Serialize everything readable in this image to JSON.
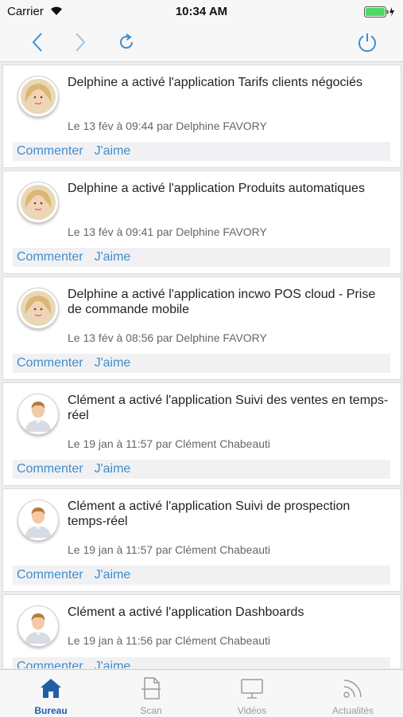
{
  "status_bar": {
    "carrier": "Carrier",
    "time": "10:34 AM"
  },
  "toolbar": {
    "back_icon": "chevron-left-icon",
    "forward_icon": "chevron-right-icon",
    "refresh_icon": "refresh-icon",
    "power_icon": "power-icon",
    "accent_color": "#3f8dcc"
  },
  "feed": {
    "items": [
      {
        "title": "Delphine a activé l'application Tarifs clients négociés",
        "meta": "Le 13 fév à 09:44 par Delphine FAVORY",
        "comment": "Commenter",
        "like": "J'aime",
        "avatar": "woman-avatar"
      },
      {
        "title": "Delphine a activé l'application Produits automatiques",
        "meta": "Le 13 fév à 09:41 par Delphine FAVORY",
        "comment": "Commenter",
        "like": "J'aime",
        "avatar": "woman-avatar"
      },
      {
        "title": "Delphine a activé l'application incwo POS cloud - Prise de commande mobile",
        "meta": "Le 13 fév à 08:56 par Delphine FAVORY",
        "comment": "Commenter",
        "like": "J'aime",
        "avatar": "woman-avatar"
      },
      {
        "title": "Clément a activé l'application Suivi des ventes en temps-réel",
        "meta": "Le 19 jan à 11:57 par Clément Chabeauti",
        "comment": "Commenter",
        "like": "J'aime",
        "avatar": "man-avatar"
      },
      {
        "title": "Clément a activé l'application Suivi de prospection temps-réel",
        "meta": "Le 19 jan à 11:57 par Clément Chabeauti",
        "comment": "Commenter",
        "like": "J'aime",
        "avatar": "man-avatar"
      },
      {
        "title": "Clément a activé l'application Dashboards",
        "meta": "Le 19 jan à 11:56 par Clément Chabeauti",
        "comment": "Commenter",
        "like": "J'aime",
        "avatar": "man-avatar"
      }
    ]
  },
  "tabbar": {
    "tabs": [
      {
        "label": "Bureau",
        "icon": "house-icon",
        "active": true
      },
      {
        "label": "Scan",
        "icon": "scan-document-icon",
        "active": false
      },
      {
        "label": "Vidéos",
        "icon": "monitor-icon",
        "active": false
      },
      {
        "label": "Actualités",
        "icon": "rss-feed-icon",
        "active": false
      }
    ],
    "active_color": "#1f5fa6",
    "inactive_color": "#9c9c9c"
  }
}
